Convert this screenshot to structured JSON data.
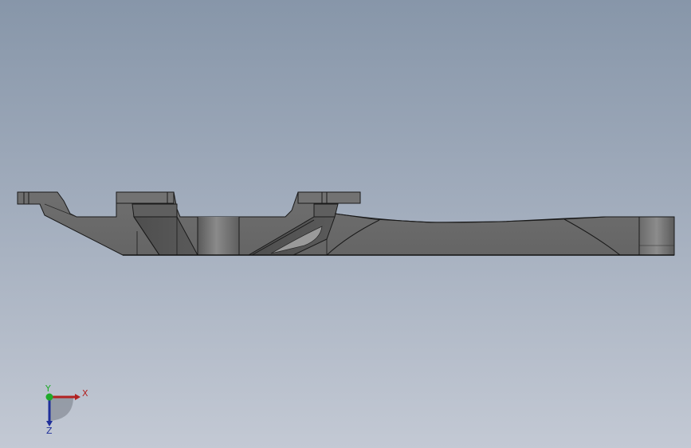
{
  "viewport": {
    "background_top": "#8796a9",
    "background_bottom": "#c3c9d4"
  },
  "part": {
    "fill_color": "#6b6b6b",
    "edge_color": "#1a1a1a"
  },
  "triad": {
    "x_label": "X",
    "y_label": "Y",
    "z_label": "Z",
    "x_color": "#b22222",
    "y_color": "#1faa2a",
    "z_color": "#1f2f9a"
  }
}
